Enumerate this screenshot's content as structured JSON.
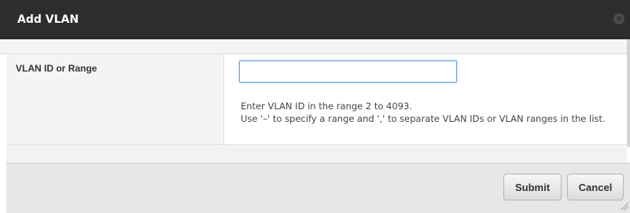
{
  "dialog": {
    "title": "Add VLAN",
    "close_icon": "close-icon"
  },
  "form": {
    "vlan_field": {
      "label": "VLAN ID or Range",
      "value": "",
      "placeholder": ""
    },
    "help_lines": [
      "Enter VLAN ID in the range 2 to 4093.",
      "Use '–' to specify a range and ',' to separate VLAN IDs or VLAN ranges in the list."
    ]
  },
  "footer": {
    "submit_label": "Submit",
    "cancel_label": "Cancel"
  },
  "colors": {
    "titlebar": "#2d2d2d",
    "input_focus": "#6aa0d6"
  }
}
